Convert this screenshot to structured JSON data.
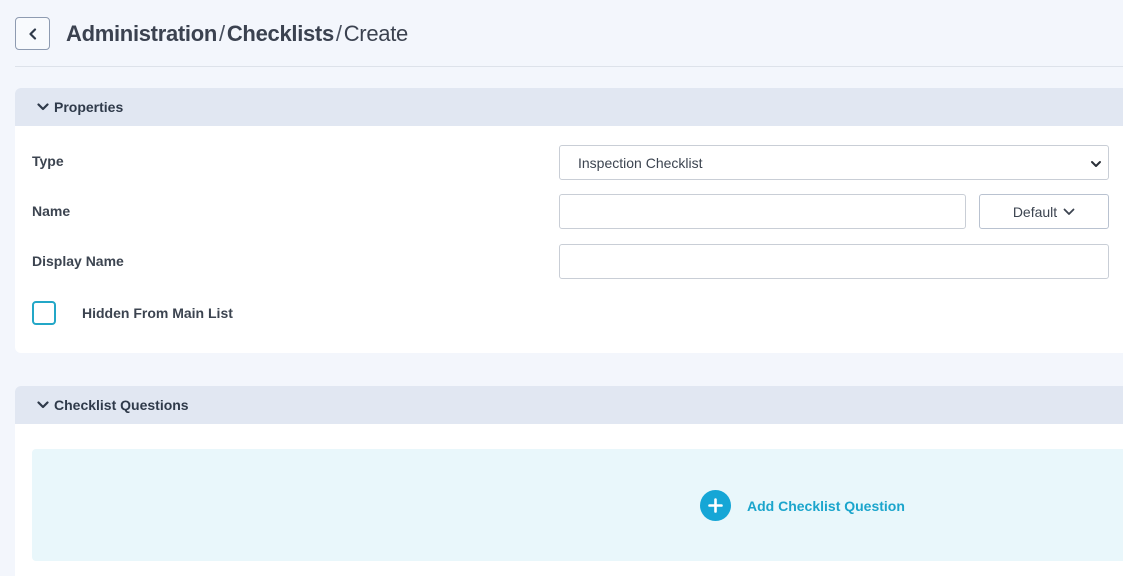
{
  "breadcrumb": {
    "items": [
      "Administration",
      "Checklists",
      "Create"
    ],
    "separator": "/"
  },
  "properties": {
    "title": "Properties",
    "type_label": "Type",
    "type_value": "Inspection Checklist",
    "name_label": "Name",
    "name_value": "",
    "default_label": "Default",
    "display_name_label": "Display Name",
    "display_name_value": "",
    "hidden_label": "Hidden From Main List",
    "hidden_checked": false
  },
  "questions": {
    "title": "Checklist Questions",
    "add_label": "Add Checklist Question"
  },
  "colors": {
    "accent": "#16a6d6",
    "page_bg": "#f3f6fc",
    "section_header_bg": "#e1e7f2",
    "add_area_bg": "#e9f7fb"
  },
  "icons": {
    "back": "chevron-left-icon",
    "collapse": "chevron-down-icon",
    "select_caret": "chevron-down-icon",
    "add": "plus-circle-icon"
  }
}
